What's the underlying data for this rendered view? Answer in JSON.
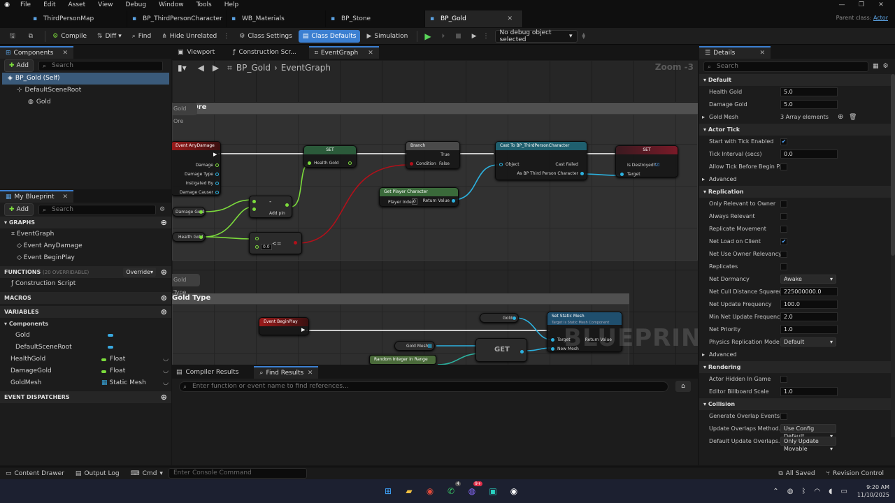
{
  "menu": [
    "File",
    "Edit",
    "Asset",
    "View",
    "Debug",
    "Window",
    "Tools",
    "Help"
  ],
  "tabs": [
    {
      "label": "ThirdPersonMap",
      "active": false
    },
    {
      "label": "BP_ThirdPersonCharacter",
      "active": false
    },
    {
      "label": "WB_Materials",
      "active": false
    },
    {
      "label": "BP_Stone",
      "active": false
    },
    {
      "label": "BP_Gold",
      "active": true
    }
  ],
  "window": {
    "parent_class_label": "Parent class:",
    "parent_class_value": "Actor"
  },
  "toolbar": {
    "compile": "Compile",
    "diff": "Diff",
    "find": "Find",
    "hide_unrelated": "Hide Unrelated",
    "class_settings": "Class Settings",
    "class_defaults": "Class Defaults",
    "simulation": "Simulation",
    "debug_object": "No debug object selected"
  },
  "components_panel": {
    "tab": "Components",
    "add": "Add",
    "search_placeholder": "Search",
    "tree": [
      {
        "label": "BP_Gold (Self)",
        "level": 0
      },
      {
        "label": "DefaultSceneRoot",
        "level": 1
      },
      {
        "label": "Gold",
        "level": 2
      }
    ]
  },
  "my_blueprint": {
    "tab": "My Blueprint",
    "add": "Add",
    "search_placeholder": "Search",
    "graphs_header": "GRAPHS",
    "event_graph": "EventGraph",
    "events": [
      "Event AnyDamage",
      "Event BeginPlay"
    ],
    "functions_header": "FUNCTIONS",
    "functions_count": "(20 OVERRIDABLE)",
    "override": "Override",
    "construction_script": "Construction Script",
    "macros_header": "MACROS",
    "variables_header": "VARIABLES",
    "components_header": "Components",
    "component_vars": [
      "Gold",
      "DefaultSceneRoot"
    ],
    "variables": [
      {
        "name": "HealthGold",
        "type": "Float",
        "color": "#7cdc3c"
      },
      {
        "name": "DamageGold",
        "type": "Float",
        "color": "#7cdc3c"
      },
      {
        "name": "GoldMesh",
        "type": "Static Mesh",
        "color": "#39a9e0"
      }
    ],
    "dispatchers_header": "EVENT DISPATCHERS"
  },
  "graph": {
    "tabs": [
      "Viewport",
      "Construction Scr...",
      "EventGraph"
    ],
    "breadcrumb_root": "BP_Gold",
    "breadcrumb_sep": "›",
    "breadcrumb_leaf": "EventGraph",
    "zoom": "Zoom -3",
    "watermark": "BLUEPRINT",
    "comments": [
      {
        "tag": "Gold Ore",
        "title": "Gold Ore"
      },
      {
        "tag": "Gold Type",
        "title": "Gold Type"
      }
    ],
    "nodes": {
      "any_damage": {
        "title": "Event AnyDamage",
        "pins": [
          "Damage",
          "Damage Type",
          "Instigated By",
          "Damage Causer"
        ]
      },
      "damage_gold": "Damage Gold",
      "health_gold": "Health Gold",
      "subtract": {
        "symbol": "-",
        "add_pin": "Add pin"
      },
      "lte": {
        "symbol": "<=",
        "value": "0.0"
      },
      "set1": {
        "title": "SET",
        "pin": "Health Gold"
      },
      "branch": {
        "title": "Branch",
        "condition": "Condition",
        "true": "True",
        "false": "False"
      },
      "get_player": {
        "title": "Get Player Character",
        "player_index": "Player Index",
        "index_value": "0",
        "return": "Return Value"
      },
      "cast": {
        "title": "Cast To BP_ThirdPersonCharacter",
        "object": "Object",
        "cast_failed": "Cast Failed",
        "as": "As BP Third Person Character"
      },
      "set2": {
        "title": "SET",
        "is_destroyed": "Is Destroyed?",
        "target": "Target"
      },
      "begin_play": "Event BeginPlay",
      "gold": "Gold",
      "gold_mesh": "Gold Mesh",
      "get": "GET",
      "random": "Random Integer in Range",
      "set_static_mesh": {
        "title": "Set Static Mesh",
        "subtitle": "Target is Static Mesh Component",
        "target": "Target",
        "new_mesh": "New Mesh",
        "return": "Return Value"
      }
    }
  },
  "bottom": {
    "tabs": [
      "Compiler Results",
      "Find Results"
    ],
    "find_placeholder": "Enter function or event name to find references..."
  },
  "details": {
    "tab": "Details",
    "search_placeholder": "Search",
    "sections": [
      {
        "title": "Default",
        "rows": [
          {
            "label": "Health Gold",
            "kind": "val",
            "value": "5.0"
          },
          {
            "label": "Damage Gold",
            "kind": "val",
            "value": "5.0"
          },
          {
            "label": "Gold Mesh",
            "kind": "text",
            "value": "3 Array elements",
            "expand": true
          }
        ]
      },
      {
        "title": "Actor Tick",
        "rows": [
          {
            "label": "Start with Tick Enabled",
            "kind": "chk",
            "checked": true
          },
          {
            "label": "Tick Interval (secs)",
            "kind": "val",
            "value": "0.0"
          },
          {
            "label": "Allow Tick Before Begin P...",
            "kind": "chk",
            "checked": false
          },
          {
            "label": "Advanced",
            "kind": "sub"
          }
        ]
      },
      {
        "title": "Replication",
        "rows": [
          {
            "label": "Only Relevant to Owner",
            "kind": "chk",
            "checked": false
          },
          {
            "label": "Always Relevant",
            "kind": "chk",
            "checked": false
          },
          {
            "label": "Replicate Movement",
            "kind": "chk",
            "checked": false
          },
          {
            "label": "Net Load on Client",
            "kind": "chk",
            "checked": true
          },
          {
            "label": "Net Use Owner Relevancy",
            "kind": "chk",
            "checked": false
          },
          {
            "label": "Replicates",
            "kind": "chk",
            "checked": false
          },
          {
            "label": "Net Dormancy",
            "kind": "drop",
            "value": "Awake"
          },
          {
            "label": "Net Cull Distance Squared",
            "kind": "val",
            "value": "225000000.0"
          },
          {
            "label": "Net Update Frequency",
            "kind": "val",
            "value": "100.0"
          },
          {
            "label": "Min Net Update Frequency",
            "kind": "val",
            "value": "2.0"
          },
          {
            "label": "Net Priority",
            "kind": "val",
            "value": "1.0"
          },
          {
            "label": "Physics Replication Mode",
            "kind": "drop",
            "value": "Default"
          },
          {
            "label": "Advanced",
            "kind": "sub"
          }
        ]
      },
      {
        "title": "Rendering",
        "rows": [
          {
            "label": "Actor Hidden In Game",
            "kind": "chk",
            "checked": false
          },
          {
            "label": "Editor Billboard Scale",
            "kind": "val",
            "value": "1.0"
          }
        ]
      },
      {
        "title": "Collision",
        "rows": [
          {
            "label": "Generate Overlap Events...",
            "kind": "chk",
            "checked": false
          },
          {
            "label": "Update Overlaps Method...",
            "kind": "drop",
            "value": "Use Config Default"
          },
          {
            "label": "Default Update Overlaps...",
            "kind": "drop",
            "value": "Only Update Movable"
          }
        ]
      }
    ]
  },
  "status": {
    "content_drawer": "Content Drawer",
    "output_log": "Output Log",
    "cmd": "Cmd",
    "console_placeholder": "Enter Console Command",
    "all_saved": "All Saved",
    "revision": "Revision Control"
  },
  "taskbar": {
    "time": "9:20 AM",
    "date": "11/10/2025",
    "badge1": "4",
    "badge2": "9+"
  }
}
